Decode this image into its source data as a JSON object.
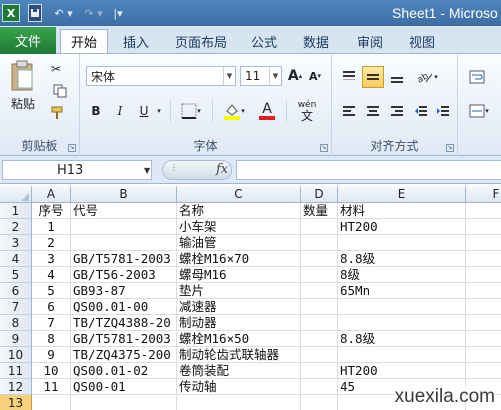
{
  "window": {
    "title": "Sheet1 - Microso"
  },
  "quick_access": {
    "logo": "X",
    "undo": "↶",
    "redo": "↷",
    "more": "|▾"
  },
  "tabs": {
    "file": "文件",
    "items": [
      "开始",
      "插入",
      "页面布局",
      "公式",
      "数据",
      "审阅",
      "视图"
    ],
    "active": "开始"
  },
  "ribbon": {
    "clipboard": {
      "label": "剪贴板",
      "paste": "粘贴"
    },
    "font": {
      "label": "字体",
      "name": "宋体",
      "size": "11",
      "bold": "B",
      "italic": "I",
      "underline": "U",
      "grow": "A",
      "shrink": "A",
      "font_color": "A",
      "wen": "wén"
    },
    "alignment": {
      "label": "对齐方式"
    }
  },
  "formula_bar": {
    "name_box": "H13",
    "fx": "fx",
    "formula": ""
  },
  "colors": {
    "accent": "#3c6ea4",
    "file_tab": "#1f7a36",
    "selected_row": "#f7d17a"
  },
  "grid": {
    "columns": [
      "A",
      "B",
      "C",
      "D",
      "E",
      "F"
    ],
    "rows": [
      {
        "n": "1",
        "A": "序号",
        "B": "代号",
        "C": "名称",
        "D": "数量",
        "E": "材料"
      },
      {
        "n": "2",
        "A": "1",
        "B": "",
        "C": "小车架",
        "D": "",
        "E": "HT200"
      },
      {
        "n": "3",
        "A": "2",
        "B": "",
        "C": "输油管",
        "D": "",
        "E": ""
      },
      {
        "n": "4",
        "A": "3",
        "B": "GB/T5781-2003",
        "C": "螺栓M16×70",
        "D": "",
        "E": "8.8级"
      },
      {
        "n": "5",
        "A": "4",
        "B": "GB/T56-2003",
        "C": "螺母M16",
        "D": "",
        "E": "8级"
      },
      {
        "n": "6",
        "A": "5",
        "B": "GB93-87",
        "C": "垫片",
        "D": "",
        "E": "65Mn"
      },
      {
        "n": "7",
        "A": "6",
        "B": "QS00.01-00",
        "C": "减速器",
        "D": "",
        "E": ""
      },
      {
        "n": "8",
        "A": "7",
        "B": "TB/TZQ4388-20",
        "C": "制动器",
        "D": "",
        "E": ""
      },
      {
        "n": "9",
        "A": "8",
        "B": "GB/T5781-2003",
        "C": "螺栓M16×50",
        "D": "",
        "E": "8.8级"
      },
      {
        "n": "10",
        "A": "9",
        "B": "TB/ZQ4375-200",
        "C": "制动轮齿式联轴器",
        "D": "",
        "E": ""
      },
      {
        "n": "11",
        "A": "10",
        "B": "QS00.01-02",
        "C": "卷筒装配",
        "D": "",
        "E": "HT200"
      },
      {
        "n": "12",
        "A": "11",
        "B": "QS00-01",
        "C": "传动轴",
        "D": "",
        "E": "45"
      },
      {
        "n": "13",
        "A": "",
        "B": "",
        "C": "",
        "D": "",
        "E": ""
      }
    ]
  },
  "watermark": "xuexila.com"
}
